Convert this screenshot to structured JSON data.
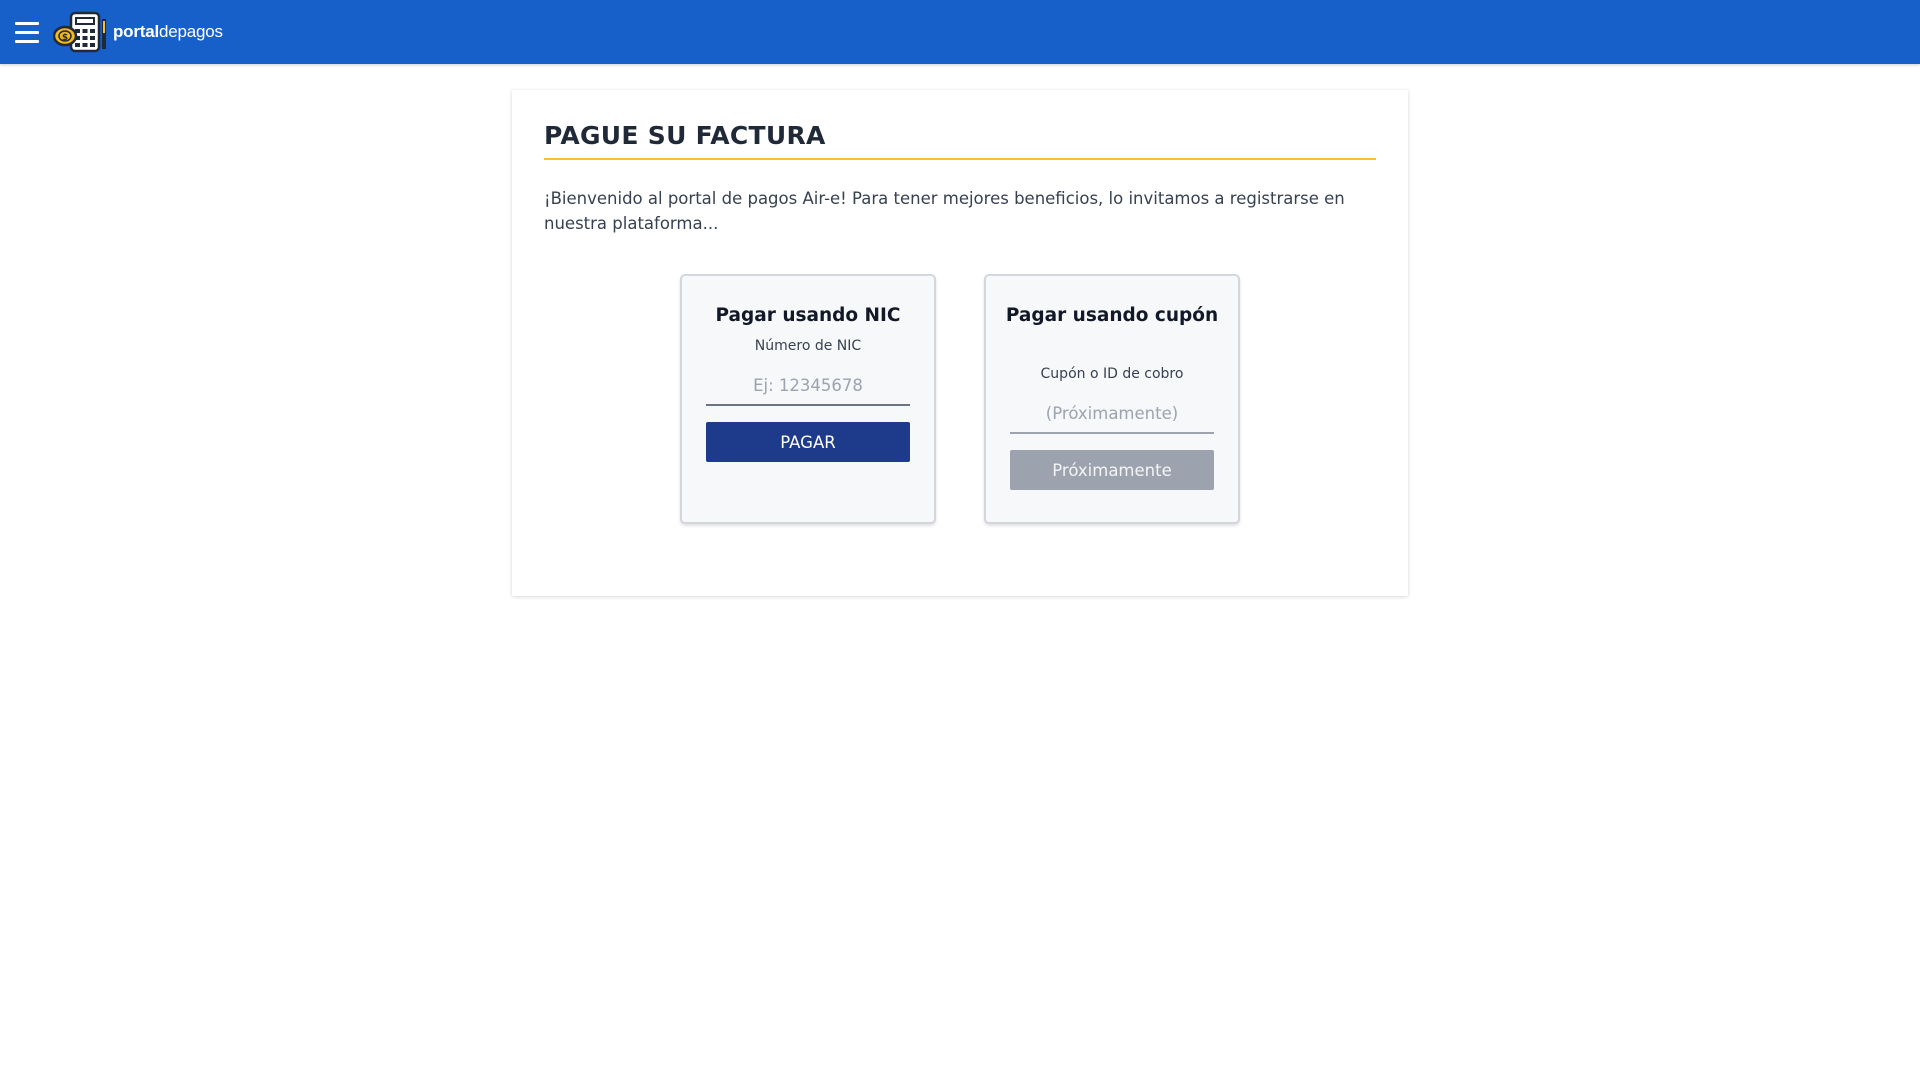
{
  "header": {
    "logo_bold": "portal",
    "logo_light": "depagos",
    "menu_icon": "hamburger-menu-icon",
    "logo_icon": "calculator-coin-icon"
  },
  "main": {
    "title": "PAGUE SU FACTURA",
    "welcome": "¡Bienvenido al portal de pagos Air-e! Para tener mejores beneficios, lo invitamos a registrarse en nuestra plataforma..."
  },
  "nic_option": {
    "title": "Pagar usando NIC",
    "label": "Número de NIC",
    "placeholder": "Ej: 12345678",
    "value": "",
    "button": "PAGAR"
  },
  "coupon_option": {
    "title": "Pagar usando cupón",
    "label": "Cupón o ID de cobro",
    "placeholder": "(Próximamente)",
    "value": "",
    "button": "Próximamente"
  },
  "colors": {
    "header_bg": "#1860c9",
    "title_rule": "#f6c12a",
    "primary_button": "#1e3a8a",
    "disabled_button": "#9ca3af"
  }
}
